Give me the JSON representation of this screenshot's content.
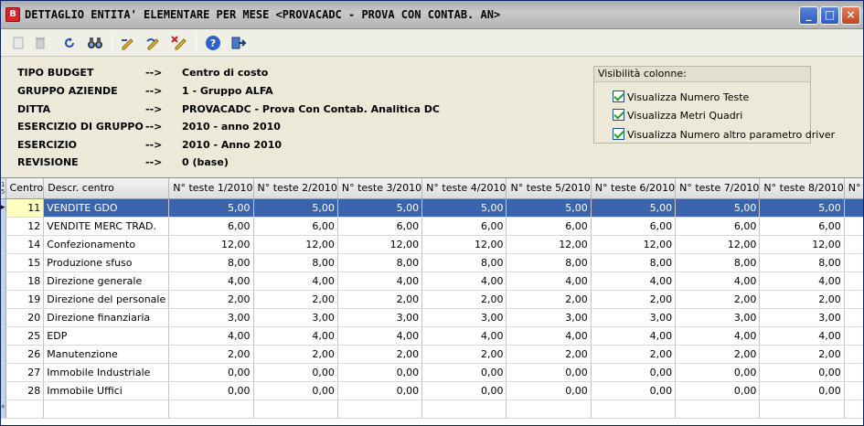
{
  "window": {
    "app_icon_letter": "B",
    "title": "DETTAGLIO ENTITA' ELEMENTARE PER MESE <PROVACADC - PROVA CON CONTAB. AN>",
    "minimize": "_",
    "maximize": "□",
    "close": "×"
  },
  "info": [
    {
      "label": "TIPO BUDGET",
      "arrow": "-->",
      "value": "Centro di costo"
    },
    {
      "label": "GRUPPO AZIENDE",
      "arrow": "-->",
      "value": "1 - Gruppo ALFA"
    },
    {
      "label": "DITTA",
      "arrow": "-->",
      "value": "PROVACADC - Prova Con Contab. Analitica DC"
    },
    {
      "label": "ESERCIZIO DI GRUPPO",
      "arrow": "-->",
      "value": "2010 - anno 2010"
    },
    {
      "label": "ESERCIZIO",
      "arrow": "-->",
      "value": "2010 - Anno 2010"
    },
    {
      "label": "REVISIONE",
      "arrow": "-->",
      "value": "0 (base)"
    }
  ],
  "visibility": {
    "title": "Visibilità colonne:",
    "items": [
      {
        "label": "Visualizza Numero Teste",
        "checked": true
      },
      {
        "label": "Visualizza Metri Quadri",
        "checked": true
      },
      {
        "label": "Visualizza Numero altro parametro driver",
        "checked": true
      }
    ]
  },
  "grid": {
    "corner": "1\n5",
    "columns": [
      "Centro",
      "Descr. centro",
      "N° teste 1/2010",
      "N° teste 2/2010",
      "N° teste 3/2010",
      "N° teste 4/2010",
      "N° teste 5/2010",
      "N° teste 6/2010",
      "N° teste 7/2010",
      "N° teste 8/2010",
      "N° tes"
    ],
    "rows": [
      {
        "code": "11",
        "descr": "VENDITE GDO",
        "values": [
          "5,00",
          "5,00",
          "5,00",
          "5,00",
          "5,00",
          "5,00",
          "5,00",
          "5,00"
        ],
        "selected": true
      },
      {
        "code": "12",
        "descr": "VENDITE MERC TRAD.",
        "values": [
          "6,00",
          "6,00",
          "6,00",
          "6,00",
          "6,00",
          "6,00",
          "6,00",
          "6,00"
        ]
      },
      {
        "code": "14",
        "descr": "Confezionamento",
        "values": [
          "12,00",
          "12,00",
          "12,00",
          "12,00",
          "12,00",
          "12,00",
          "12,00",
          "12,00"
        ]
      },
      {
        "code": "15",
        "descr": "Produzione sfuso",
        "values": [
          "8,00",
          "8,00",
          "8,00",
          "8,00",
          "8,00",
          "8,00",
          "8,00",
          "8,00"
        ]
      },
      {
        "code": "18",
        "descr": "Direzione generale",
        "values": [
          "4,00",
          "4,00",
          "4,00",
          "4,00",
          "4,00",
          "4,00",
          "4,00",
          "4,00"
        ]
      },
      {
        "code": "19",
        "descr": "Direzione del personale",
        "values": [
          "2,00",
          "2,00",
          "2,00",
          "2,00",
          "2,00",
          "2,00",
          "2,00",
          "2,00"
        ]
      },
      {
        "code": "20",
        "descr": "Direzione finanziaria",
        "values": [
          "3,00",
          "3,00",
          "3,00",
          "3,00",
          "3,00",
          "3,00",
          "3,00",
          "3,00"
        ]
      },
      {
        "code": "25",
        "descr": "EDP",
        "values": [
          "4,00",
          "4,00",
          "4,00",
          "4,00",
          "4,00",
          "4,00",
          "4,00",
          "4,00"
        ]
      },
      {
        "code": "26",
        "descr": "Manutenzione",
        "values": [
          "2,00",
          "2,00",
          "2,00",
          "2,00",
          "2,00",
          "2,00",
          "2,00",
          "2,00"
        ]
      },
      {
        "code": "27",
        "descr": "Immobile Industriale",
        "values": [
          "0,00",
          "0,00",
          "0,00",
          "0,00",
          "0,00",
          "0,00",
          "0,00",
          "0,00"
        ]
      },
      {
        "code": "28",
        "descr": "Immobile Uffici",
        "values": [
          "0,00",
          "0,00",
          "0,00",
          "0,00",
          "0,00",
          "0,00",
          "0,00",
          "0,00"
        ]
      }
    ],
    "new_row_marker": "*",
    "selected_marker": "▸"
  },
  "toolbar": {
    "icons": [
      "new-icon",
      "delete-icon",
      "refresh-icon",
      "search-binoculars-icon",
      "edit-pencil-icon",
      "edit-undo-icon",
      "edit-cancel-icon",
      "help-icon",
      "exit-icon"
    ]
  }
}
